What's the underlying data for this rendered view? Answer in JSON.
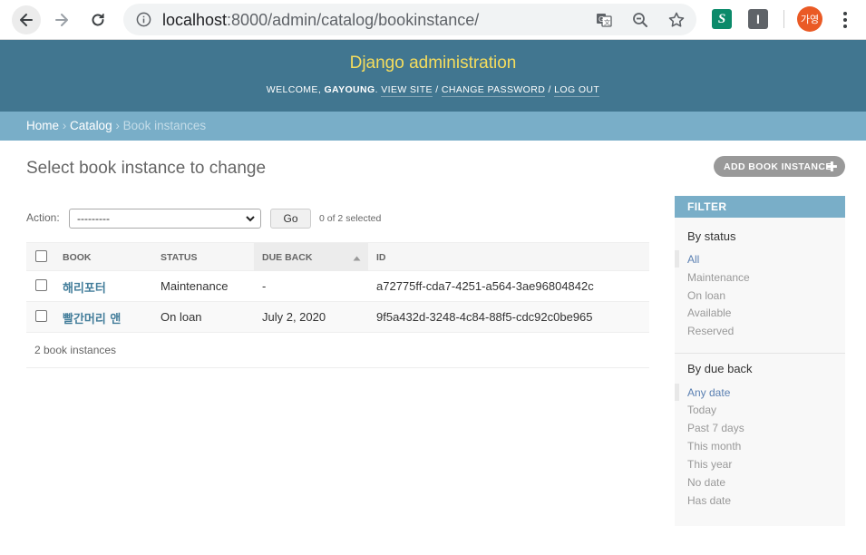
{
  "browser": {
    "url_host": "localhost",
    "url_path": ":8000/admin/catalog/bookinstance/",
    "profile_initials": "가영",
    "ext_s": "S",
    "ext_i": "I"
  },
  "header": {
    "branding": "Django administration",
    "welcome": "Welcome,",
    "user": "Gayoung",
    "view_site": "View site",
    "change_password": "Change password",
    "log_out": "Log out"
  },
  "breadcrumbs": {
    "home": "Home",
    "catalog": "Catalog",
    "current": "Book instances",
    "sep": "›"
  },
  "content": {
    "title": "Select book instance to change",
    "add_button": "ADD BOOK INSTANCE"
  },
  "actions": {
    "label": "Action:",
    "selected_value": "---------",
    "go": "Go",
    "counter": "0 of 2 selected"
  },
  "table": {
    "headers": [
      "BOOK",
      "STATUS",
      "DUE BACK",
      "ID"
    ],
    "rows": [
      {
        "book": "해리포터",
        "status": "Maintenance",
        "due_back": "-",
        "id": "a72775ff-cda7-4251-a564-3ae96804842c"
      },
      {
        "book": "빨간머리 앤",
        "status": "On loan",
        "due_back": "July 2, 2020",
        "id": "9f5a432d-3248-4c84-88f5-cdc92c0be965"
      }
    ],
    "count": "2 book instances"
  },
  "filter": {
    "title": "Filter",
    "by_status": {
      "title": "By status",
      "options": [
        "All",
        "Maintenance",
        "On loan",
        "Available",
        "Reserved"
      ],
      "selected": "All"
    },
    "by_due_back": {
      "title": "By due back",
      "options": [
        "Any date",
        "Today",
        "Past 7 days",
        "This month",
        "This year",
        "No date",
        "Has date"
      ],
      "selected": "Any date"
    }
  },
  "colors": {
    "header_bg": "#417690",
    "branding": "#f5dd5d",
    "breadcrumbs_bg": "#79aec8",
    "link": "#447e9b"
  }
}
